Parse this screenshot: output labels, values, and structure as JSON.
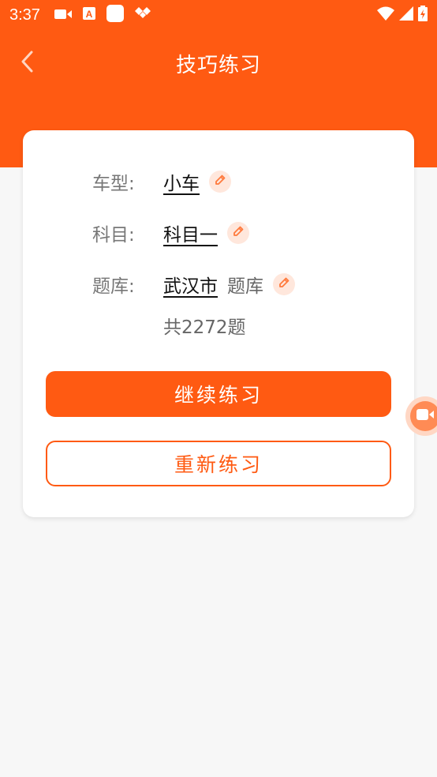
{
  "status_bar": {
    "time": "3:37",
    "icons_left": [
      "video-icon",
      "a-box-icon",
      "square-icon",
      "diamond-icon"
    ],
    "icons_right": [
      "wifi-icon",
      "signal-icon",
      "battery-icon"
    ]
  },
  "app_bar": {
    "title": "技巧练习",
    "back_icon": "chevron-left-icon"
  },
  "card": {
    "car_type": {
      "label": "车型:",
      "value": "小车"
    },
    "subject": {
      "label": "科目:",
      "value": "科目一"
    },
    "bank": {
      "label": "题库:",
      "value": "武汉市",
      "suffix": "题库"
    },
    "count_text": "共2272题",
    "continue_label": "继续练习",
    "restart_label": "重新练习"
  },
  "colors": {
    "brand": "#ff5a12",
    "edit_bg": "#ffe7dc",
    "background": "#f7f7f7"
  }
}
